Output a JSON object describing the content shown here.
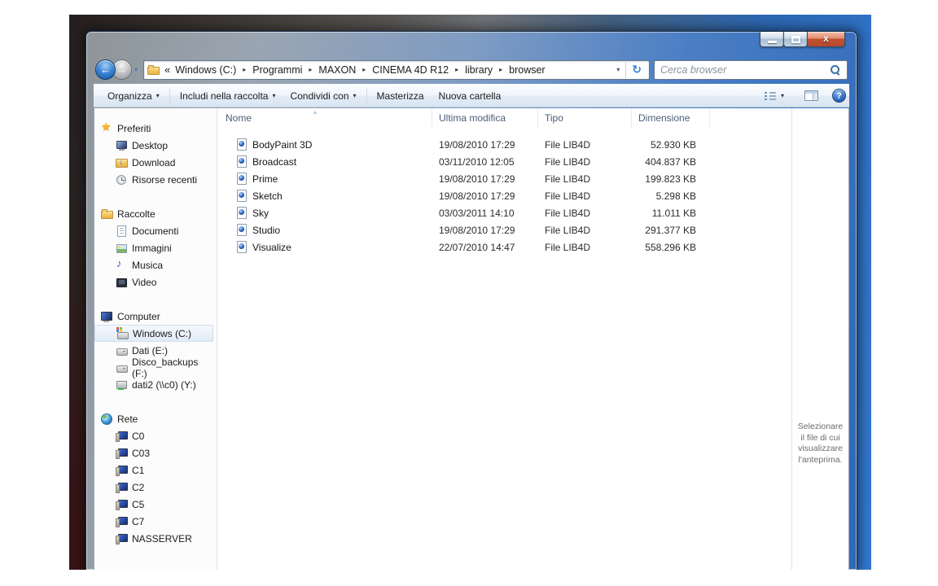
{
  "address": {
    "overflow": "«",
    "crumbs": [
      "Windows (C:)",
      "Programmi",
      "MAXON",
      "CINEMA 4D R12",
      "library",
      "browser"
    ]
  },
  "search": {
    "placeholder": "Cerca browser"
  },
  "toolbar": {
    "items": [
      {
        "label": "Organizza",
        "dropdown": true
      },
      {
        "label": "Includi nella raccolta",
        "dropdown": true
      },
      {
        "label": "Condividi con",
        "dropdown": true
      },
      {
        "label": "Masterizza",
        "dropdown": false
      },
      {
        "label": "Nuova cartella",
        "dropdown": false
      }
    ]
  },
  "sidebar": {
    "sections": [
      {
        "label": "Preferiti",
        "icon": "star-icon",
        "items": [
          {
            "label": "Desktop",
            "icon": "desktop-icon"
          },
          {
            "label": "Download",
            "icon": "download-folder-icon"
          },
          {
            "label": "Risorse recenti",
            "icon": "recent-places-icon"
          }
        ]
      },
      {
        "label": "Raccolte",
        "icon": "libraries-icon",
        "items": [
          {
            "label": "Documenti",
            "icon": "documents-icon"
          },
          {
            "label": "Immagini",
            "icon": "pictures-icon"
          },
          {
            "label": "Musica",
            "icon": "music-icon"
          },
          {
            "label": "Video",
            "icon": "videos-icon"
          }
        ]
      },
      {
        "label": "Computer",
        "icon": "computer-icon",
        "items": [
          {
            "label": "Windows (C:)",
            "icon": "system-drive-icon",
            "selected": true
          },
          {
            "label": "Dati (E:)",
            "icon": "drive-icon",
            "selected": false
          },
          {
            "label": "Disco_backups (F:)",
            "icon": "drive-icon",
            "selected": false
          },
          {
            "label": "dati2 (\\\\c0) (Y:)",
            "icon": "network-drive-icon",
            "selected": false
          }
        ]
      },
      {
        "label": "Rete",
        "icon": "network-icon",
        "items": [
          {
            "label": "C0",
            "icon": "network-computer-icon"
          },
          {
            "label": "C03",
            "icon": "network-computer-icon"
          },
          {
            "label": "C1",
            "icon": "network-computer-icon"
          },
          {
            "label": "C2",
            "icon": "network-computer-icon"
          },
          {
            "label": "C5",
            "icon": "network-computer-icon"
          },
          {
            "label": "C7",
            "icon": "network-computer-icon"
          },
          {
            "label": "NASSERVER",
            "icon": "network-computer-icon"
          }
        ]
      }
    ]
  },
  "files": {
    "columns": [
      "Nome",
      "Ultima modifica",
      "Tipo",
      "Dimensione"
    ],
    "sort_column": "Nome",
    "sort_direction": "ascending",
    "rows": [
      {
        "name": "BodyPaint 3D",
        "modified": "19/08/2010 17:29",
        "type": "File LIB4D",
        "size": "52.930 KB"
      },
      {
        "name": "Broadcast",
        "modified": "03/11/2010 12:05",
        "type": "File LIB4D",
        "size": "404.837 KB"
      },
      {
        "name": "Prime",
        "modified": "19/08/2010 17:29",
        "type": "File LIB4D",
        "size": "199.823 KB"
      },
      {
        "name": "Sketch",
        "modified": "19/08/2010 17:29",
        "type": "File LIB4D",
        "size": "5.298 KB"
      },
      {
        "name": "Sky",
        "modified": "03/03/2011 14:10",
        "type": "File LIB4D",
        "size": "11.011 KB"
      },
      {
        "name": "Studio",
        "modified": "19/08/2010 17:29",
        "type": "File LIB4D",
        "size": "291.377 KB"
      },
      {
        "name": "Visualize",
        "modified": "22/07/2010 14:47",
        "type": "File LIB4D",
        "size": "558.296 KB"
      }
    ]
  },
  "preview": {
    "message": "Selezionare il file di cui visualizzare l'anteprima."
  },
  "colors": {
    "glass_blue": "#2f6ab8",
    "close_button_red": "#c2502f",
    "selection_bg": "#e9f1f9",
    "header_text": "#4a5e78"
  }
}
